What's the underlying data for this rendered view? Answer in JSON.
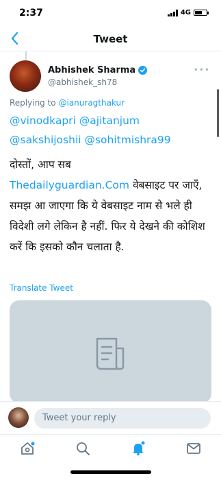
{
  "status_bar": {
    "time": "2:37",
    "network": "4G",
    "battery_level": 0.6
  },
  "nav": {
    "title": "Tweet",
    "back_icon": "chevron-left-icon"
  },
  "tweet": {
    "author_name": "Abhishek Sharma",
    "author_handle": "@abhishek_sh78",
    "verified": true,
    "replying_prefix": "Replying to",
    "replying_to": "@ianuragthakur",
    "mentions_line1": "@vinodkapri @ajitanjum",
    "mentions_line2": "@sakshijoshii @sohitmishra99",
    "text_before": "दोस्तों, आप सब",
    "link": "Thedailyguardian.Com",
    "text_after": " वेबसाइट पर जाएँ, समझ आ जाएगा कि ये वेबसाइट नाम से भले ही विदेशी लगे लेकिन है नहीं. फिर ये देखने की कोशिश करें कि इसको कौन चलाता है.",
    "translate_label": "Translate Tweet",
    "more_label": "•••"
  },
  "reply_bar": {
    "placeholder": "Tweet your reply"
  },
  "tabs": [
    "home-icon",
    "search-icon",
    "notifications-icon",
    "messages-icon"
  ],
  "colors": {
    "accent": "#1da1f2",
    "media_bg": "#ccd6dd"
  }
}
